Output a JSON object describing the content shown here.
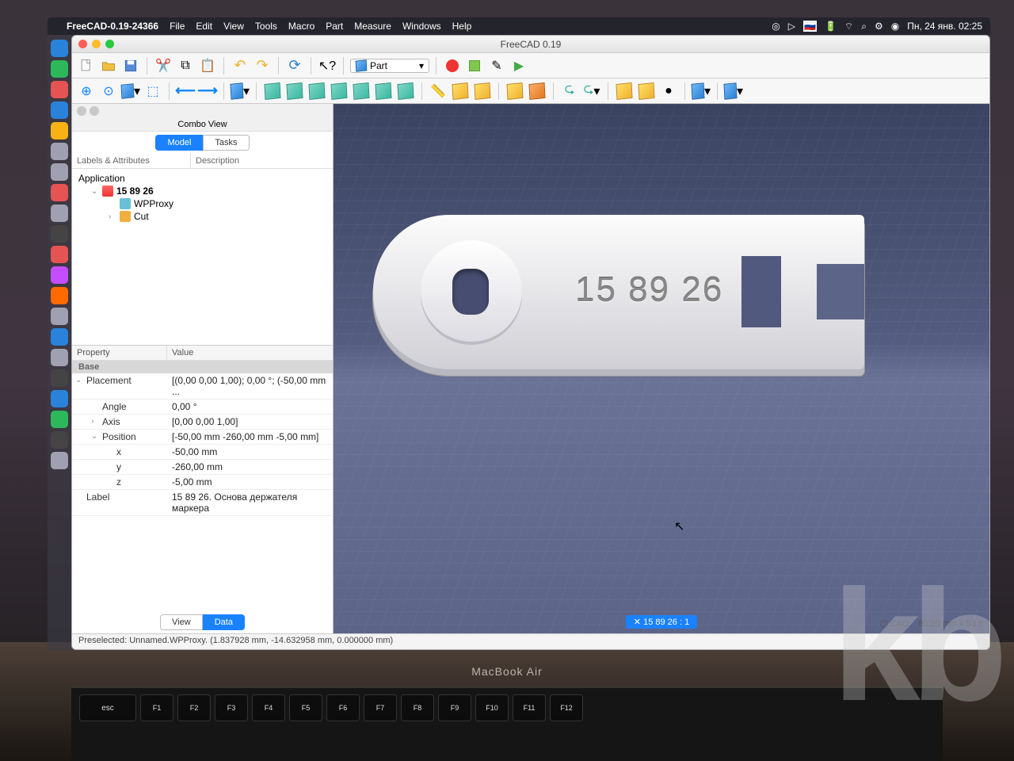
{
  "menubar": {
    "app_name": "FreeCAD-0.19-24366",
    "items": [
      "File",
      "Edit",
      "View",
      "Tools",
      "Macro",
      "Part",
      "Measure",
      "Windows",
      "Help"
    ],
    "clock": "Пн, 24 янв.  02:25"
  },
  "window": {
    "title": "FreeCAD 0.19",
    "workbench": "Part"
  },
  "combo": {
    "title": "Combo View",
    "tabs": {
      "model": "Model",
      "tasks": "Tasks"
    },
    "tree_headers": {
      "labels": "Labels & Attributes",
      "desc": "Description"
    },
    "tree": {
      "app": "Application",
      "doc": "15 89 26",
      "wp": "WPProxy",
      "cut": "Cut"
    }
  },
  "properties": {
    "headers": {
      "property": "Property",
      "value": "Value"
    },
    "group": "Base",
    "rows": {
      "placement_k": "Placement",
      "placement_v": "[(0,00 0,00 1,00); 0,00 °; (-50,00 mm  ...",
      "angle_k": "Angle",
      "angle_v": "0,00 °",
      "axis_k": "Axis",
      "axis_v": "[0,00 0,00 1,00]",
      "position_k": "Position",
      "position_v": "[-50,00 mm  -260,00 mm  -5,00 mm]",
      "x_k": "x",
      "x_v": "-50,00 mm",
      "y_k": "y",
      "y_v": "-260,00 mm",
      "z_k": "z",
      "z_v": "-5,00 mm",
      "label_k": "Label",
      "label_v": "15 89 26. Основа держателя маркера"
    },
    "footer": {
      "view": "View",
      "data": "Data"
    }
  },
  "viewport": {
    "part_text": "15 89 26",
    "tab_label": "✕ 15 89 26 : 1",
    "footer_cad": "CAD",
    "footer_dim": "80,20 mm x 53,6"
  },
  "status": "Preselected: Unnamed.WPProxy. (1.837928 mm, -14.632958 mm, 0.000000 mm)",
  "laptop": {
    "model": "MacBook Air"
  },
  "keys_row": [
    "esc",
    "F1",
    "F2",
    "F3",
    "F4",
    "F5",
    "F6",
    "F7",
    "F8",
    "F9",
    "F10",
    "F11",
    "F12"
  ]
}
